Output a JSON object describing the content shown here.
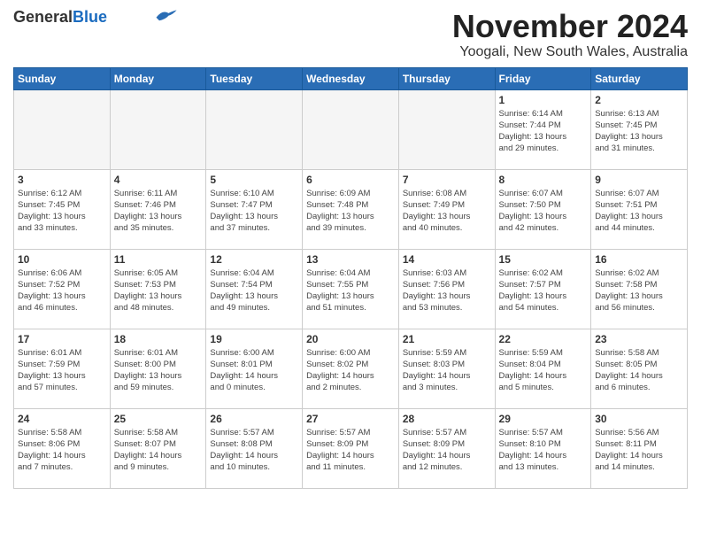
{
  "header": {
    "logo_line1": "General",
    "logo_line2": "Blue",
    "title": "November 2024",
    "subtitle": "Yoogali, New South Wales, Australia"
  },
  "days_of_week": [
    "Sunday",
    "Monday",
    "Tuesday",
    "Wednesday",
    "Thursday",
    "Friday",
    "Saturday"
  ],
  "weeks": [
    [
      {
        "day": "",
        "info": ""
      },
      {
        "day": "",
        "info": ""
      },
      {
        "day": "",
        "info": ""
      },
      {
        "day": "",
        "info": ""
      },
      {
        "day": "",
        "info": ""
      },
      {
        "day": "1",
        "info": "Sunrise: 6:14 AM\nSunset: 7:44 PM\nDaylight: 13 hours\nand 29 minutes."
      },
      {
        "day": "2",
        "info": "Sunrise: 6:13 AM\nSunset: 7:45 PM\nDaylight: 13 hours\nand 31 minutes."
      }
    ],
    [
      {
        "day": "3",
        "info": "Sunrise: 6:12 AM\nSunset: 7:45 PM\nDaylight: 13 hours\nand 33 minutes."
      },
      {
        "day": "4",
        "info": "Sunrise: 6:11 AM\nSunset: 7:46 PM\nDaylight: 13 hours\nand 35 minutes."
      },
      {
        "day": "5",
        "info": "Sunrise: 6:10 AM\nSunset: 7:47 PM\nDaylight: 13 hours\nand 37 minutes."
      },
      {
        "day": "6",
        "info": "Sunrise: 6:09 AM\nSunset: 7:48 PM\nDaylight: 13 hours\nand 39 minutes."
      },
      {
        "day": "7",
        "info": "Sunrise: 6:08 AM\nSunset: 7:49 PM\nDaylight: 13 hours\nand 40 minutes."
      },
      {
        "day": "8",
        "info": "Sunrise: 6:07 AM\nSunset: 7:50 PM\nDaylight: 13 hours\nand 42 minutes."
      },
      {
        "day": "9",
        "info": "Sunrise: 6:07 AM\nSunset: 7:51 PM\nDaylight: 13 hours\nand 44 minutes."
      }
    ],
    [
      {
        "day": "10",
        "info": "Sunrise: 6:06 AM\nSunset: 7:52 PM\nDaylight: 13 hours\nand 46 minutes."
      },
      {
        "day": "11",
        "info": "Sunrise: 6:05 AM\nSunset: 7:53 PM\nDaylight: 13 hours\nand 48 minutes."
      },
      {
        "day": "12",
        "info": "Sunrise: 6:04 AM\nSunset: 7:54 PM\nDaylight: 13 hours\nand 49 minutes."
      },
      {
        "day": "13",
        "info": "Sunrise: 6:04 AM\nSunset: 7:55 PM\nDaylight: 13 hours\nand 51 minutes."
      },
      {
        "day": "14",
        "info": "Sunrise: 6:03 AM\nSunset: 7:56 PM\nDaylight: 13 hours\nand 53 minutes."
      },
      {
        "day": "15",
        "info": "Sunrise: 6:02 AM\nSunset: 7:57 PM\nDaylight: 13 hours\nand 54 minutes."
      },
      {
        "day": "16",
        "info": "Sunrise: 6:02 AM\nSunset: 7:58 PM\nDaylight: 13 hours\nand 56 minutes."
      }
    ],
    [
      {
        "day": "17",
        "info": "Sunrise: 6:01 AM\nSunset: 7:59 PM\nDaylight: 13 hours\nand 57 minutes."
      },
      {
        "day": "18",
        "info": "Sunrise: 6:01 AM\nSunset: 8:00 PM\nDaylight: 13 hours\nand 59 minutes."
      },
      {
        "day": "19",
        "info": "Sunrise: 6:00 AM\nSunset: 8:01 PM\nDaylight: 14 hours\nand 0 minutes."
      },
      {
        "day": "20",
        "info": "Sunrise: 6:00 AM\nSunset: 8:02 PM\nDaylight: 14 hours\nand 2 minutes."
      },
      {
        "day": "21",
        "info": "Sunrise: 5:59 AM\nSunset: 8:03 PM\nDaylight: 14 hours\nand 3 minutes."
      },
      {
        "day": "22",
        "info": "Sunrise: 5:59 AM\nSunset: 8:04 PM\nDaylight: 14 hours\nand 5 minutes."
      },
      {
        "day": "23",
        "info": "Sunrise: 5:58 AM\nSunset: 8:05 PM\nDaylight: 14 hours\nand 6 minutes."
      }
    ],
    [
      {
        "day": "24",
        "info": "Sunrise: 5:58 AM\nSunset: 8:06 PM\nDaylight: 14 hours\nand 7 minutes."
      },
      {
        "day": "25",
        "info": "Sunrise: 5:58 AM\nSunset: 8:07 PM\nDaylight: 14 hours\nand 9 minutes."
      },
      {
        "day": "26",
        "info": "Sunrise: 5:57 AM\nSunset: 8:08 PM\nDaylight: 14 hours\nand 10 minutes."
      },
      {
        "day": "27",
        "info": "Sunrise: 5:57 AM\nSunset: 8:09 PM\nDaylight: 14 hours\nand 11 minutes."
      },
      {
        "day": "28",
        "info": "Sunrise: 5:57 AM\nSunset: 8:09 PM\nDaylight: 14 hours\nand 12 minutes."
      },
      {
        "day": "29",
        "info": "Sunrise: 5:57 AM\nSunset: 8:10 PM\nDaylight: 14 hours\nand 13 minutes."
      },
      {
        "day": "30",
        "info": "Sunrise: 5:56 AM\nSunset: 8:11 PM\nDaylight: 14 hours\nand 14 minutes."
      }
    ]
  ]
}
